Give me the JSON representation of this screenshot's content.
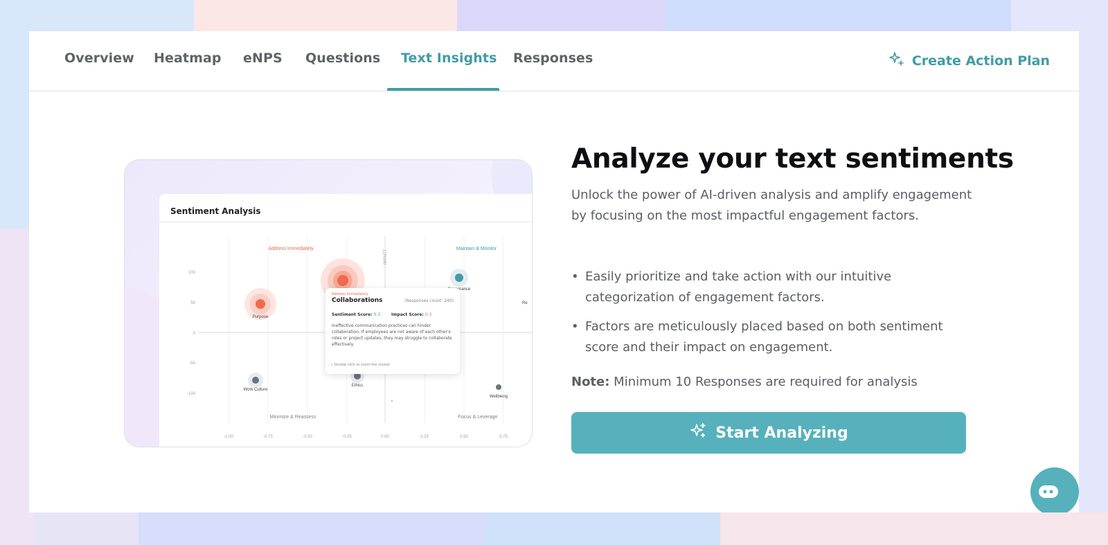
{
  "tabs": {
    "items": [
      {
        "label": "Overview"
      },
      {
        "label": "Heatmap"
      },
      {
        "label": "eNPS"
      },
      {
        "label": "Questions"
      },
      {
        "label": "Text Insights"
      },
      {
        "label": "Responses"
      }
    ],
    "active_index": 4,
    "action_plan_label": "Create Action Plan"
  },
  "illustration": {
    "card_title": "Sentiment Analysis",
    "quadrants": {
      "top_left": "Address Immediately",
      "top_right": "Maintain & Monitor",
      "bottom_left": "Minimize & Reassess",
      "bottom_right": "Focus & Leverage"
    },
    "y_axis_title": "IMPACT",
    "y_ticks": [
      "100",
      "50",
      "0",
      "-50",
      "-100"
    ],
    "x_ticks": [
      "-1.00",
      "-0.75",
      "-0.50",
      "-0.25",
      "0.00",
      "0.25",
      "0.50",
      "0.75"
    ],
    "points": [
      {
        "label": "Purpose"
      },
      {
        "label": "Work Culture"
      },
      {
        "label": "Ethics"
      },
      {
        "label": "Wellbeing"
      },
      {
        "label": "Governance"
      },
      {
        "label": "Re"
      }
    ],
    "tooltip": {
      "category": "Address Immediately",
      "title": "Collaborations",
      "count": "(Responses count: 240)",
      "sentiment_label": "Sentiment Score:",
      "sentiment_value": "0.3",
      "impact_label": "Impact Score:",
      "impact_value": "0.3",
      "description": "Ineffective communication practices can hinder collaboration. If employees are not aware of each other's roles or project updates, they may struggle to collaborate effectively.",
      "hint": "Double click to zoom the cluster"
    }
  },
  "content": {
    "headline": "Analyze your text sentiments",
    "description": "Unlock the power of AI-driven analysis and amplify engagement by focusing on the most impactful engagement factors.",
    "bullets": [
      "Easily prioritize and take action with our intuitive categorization of engagement factors.",
      "Factors are meticulously placed based on both sentiment score and their impact on engagement."
    ],
    "note_label": "Note:",
    "note_text": " Minimum 10 Responses are required for analysis",
    "start_button_label": "Start Analyzing"
  },
  "colors": {
    "accent": "#3f9ca8",
    "button": "#56b1bc",
    "critical": "#ef6a4f"
  }
}
